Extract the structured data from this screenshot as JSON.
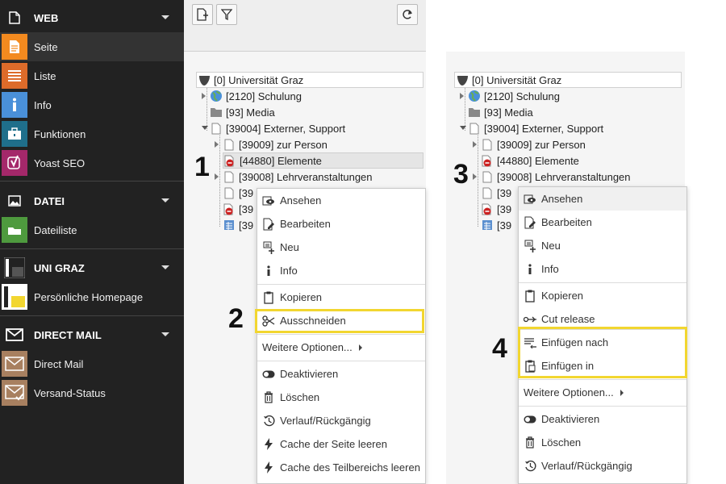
{
  "sidebar": {
    "groups": [
      {
        "label": "WEB",
        "icon": "page-icon",
        "modules": [
          {
            "label": "Seite",
            "icon": "page-module-icon",
            "color": "#f38a1f",
            "active": true
          },
          {
            "label": "Liste",
            "icon": "list-module-icon",
            "color": "#dd6b2a"
          },
          {
            "label": "Info",
            "icon": "info-module-icon",
            "color": "#4a90d9"
          },
          {
            "label": "Funktionen",
            "icon": "toolbox-module-icon",
            "color": "#1f6f8b"
          },
          {
            "label": "Yoast SEO",
            "icon": "yoast-icon",
            "color": "#a4286a"
          }
        ]
      },
      {
        "label": "DATEI",
        "icon": "image-icon",
        "modules": [
          {
            "label": "Dateiliste",
            "icon": "filelist-module-icon",
            "color": "#4e9a3e"
          }
        ]
      },
      {
        "label": "UNI GRAZ",
        "icon": "uni-graz-logo-icon",
        "modules": [
          {
            "label": "Persönliche Homepage",
            "icon": "uni-graz-logo-yellow-icon",
            "color": "#f2d630"
          }
        ]
      },
      {
        "label": "DIRECT MAIL",
        "icon": "mail-icon",
        "modules": [
          {
            "label": "Direct Mail",
            "icon": "envelope-icon",
            "color": "#a88060"
          },
          {
            "label": "Versand-Status",
            "icon": "envelope-check-icon",
            "color": "#a88060"
          }
        ]
      }
    ]
  },
  "toolbar": {
    "new_page_icon": "new-page-icon",
    "filter_icon": "filter-icon",
    "refresh_icon": "refresh-icon"
  },
  "tree": {
    "root": "[0] Universität Graz",
    "nodes": [
      {
        "label": "[2120] Schulung",
        "icon": "globe-icon"
      },
      {
        "label": "[93] Media",
        "icon": "folder-icon"
      },
      {
        "label": "[39004] Externer, Support",
        "icon": "page-icon"
      },
      {
        "label": "[39009] zur Person",
        "icon": "page-icon"
      },
      {
        "label": "[44880] Elemente",
        "icon": "page-hidden-icon"
      },
      {
        "label": "[39008] Lehrveranstaltungen",
        "icon": "page-icon"
      }
    ],
    "truncated": [
      "[39",
      "[39",
      "[39"
    ]
  },
  "menu1": {
    "items": [
      "Ansehen",
      "Bearbeiten",
      "Neu",
      "Info",
      "Kopieren",
      "Ausschneiden",
      "Weitere Optionen...",
      "Deaktivieren",
      "Löschen",
      "Verlauf/Rückgängig",
      "Cache der Seite leeren",
      "Cache des Teilbereichs leeren"
    ]
  },
  "menu2": {
    "items": [
      "Ansehen",
      "Bearbeiten",
      "Neu",
      "Info",
      "Kopieren",
      "Cut release",
      "Einfügen nach",
      "Einfügen in",
      "Weitere Optionen...",
      "Deaktivieren",
      "Löschen",
      "Verlauf/Rückgängig"
    ]
  },
  "steps": [
    "1",
    "2",
    "3",
    "4"
  ],
  "colors": {
    "highlight": "#f2d630",
    "sidebar_bg": "#222222",
    "hidden_red": "#cc2222"
  }
}
